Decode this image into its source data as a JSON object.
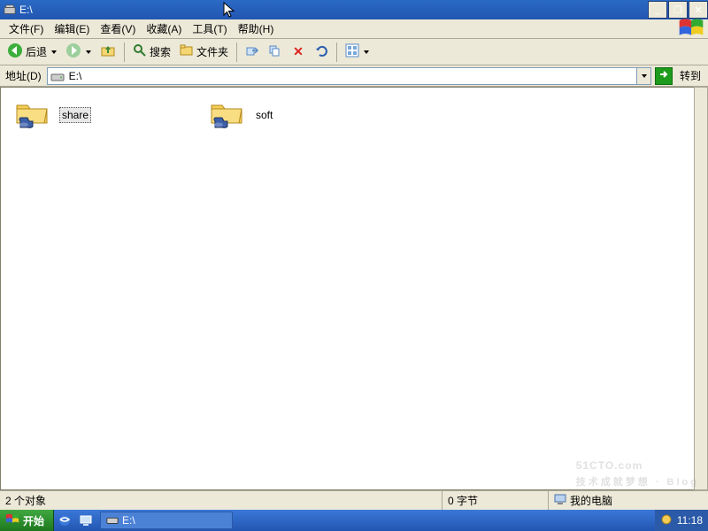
{
  "title": "E:\\",
  "menus": {
    "file": "文件(F)",
    "edit": "编辑(E)",
    "view": "查看(V)",
    "fav": "收藏(A)",
    "tools": "工具(T)",
    "help": "帮助(H)"
  },
  "toolbar": {
    "back": "后退",
    "search": "搜索",
    "folders": "文件夹"
  },
  "address": {
    "label": "地址(D)",
    "path": "E:\\",
    "go": "转到"
  },
  "items": [
    {
      "name": "share",
      "selected": true
    },
    {
      "name": "soft",
      "selected": false
    }
  ],
  "status": {
    "count_text": "2 个对象",
    "size_text": "0 字节",
    "location": "我的电脑"
  },
  "taskbar": {
    "start_label": "开始",
    "task_label": "E:\\",
    "clock": "11:18"
  },
  "watermark": {
    "line1": "51CTO.com",
    "line2": "技术成就梦想 · Blog"
  }
}
